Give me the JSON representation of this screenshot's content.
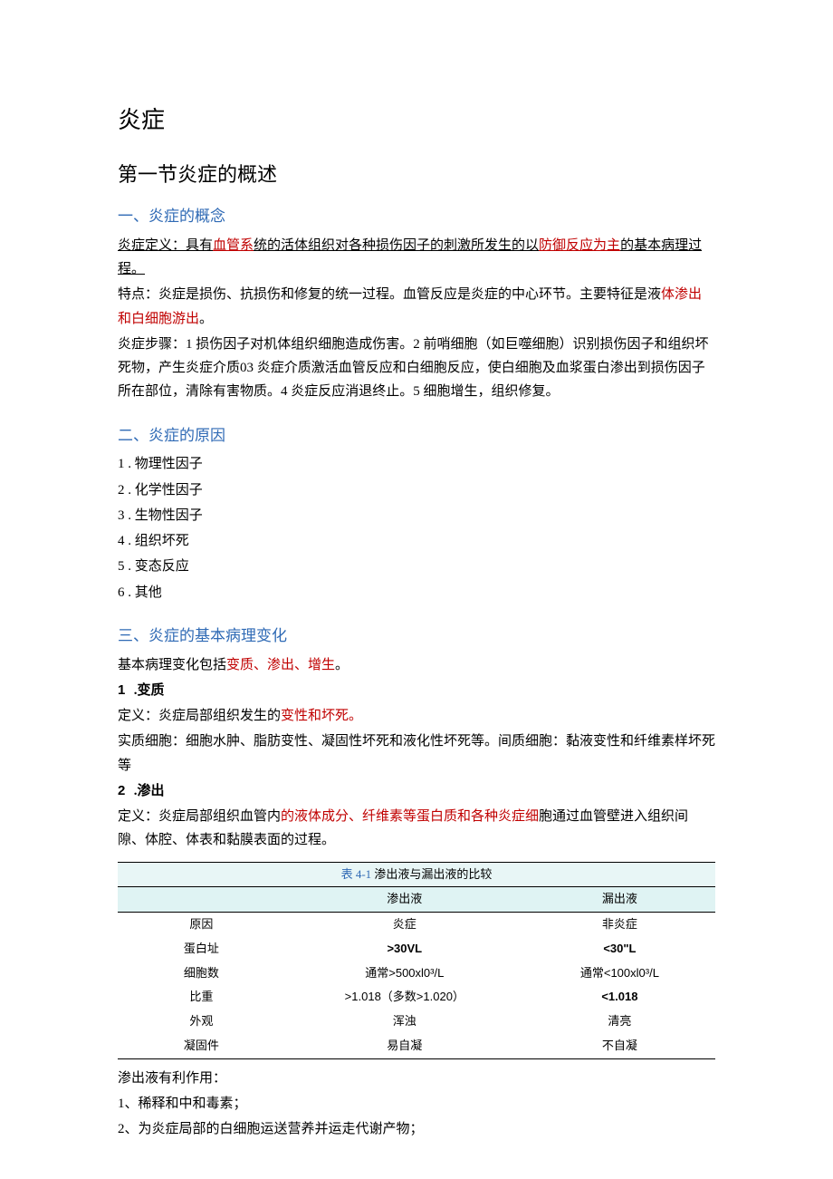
{
  "title": "炎症",
  "section1": {
    "heading": "第一节炎症的概述",
    "sub1": {
      "heading": "一、炎症的概念",
      "def_pre": "炎症定义：具有",
      "def_red1": "血管系",
      "def_mid": "统的活体组织对各种损伤因子的刺激所发生的以",
      "def_red2": "防御反应为主",
      "def_post": "的基本病理过程。",
      "feat_pre": "特点：炎症是损伤、抗损伤和修复的统一过程。血管反应是炎症的中心环节。主要特征是液",
      "feat_red": "体渗出和白细胞游出",
      "feat_post": "。",
      "steps": "炎症步骤：1 损伤因子对机体组织细胞造成伤害。2 前哨细胞（如巨噬细胞）识别损伤因子和组织坏死物，产生炎症介质03 炎症介质激活血管反应和白细胞反应，使白细胞及血浆蛋白渗出到损伤因子所在部位，清除有害物质。4 炎症反应消退终止。5 细胞增生，组织修复。"
    },
    "sub2": {
      "heading": "二、炎症的原因",
      "items": [
        "1 . 物理性因子",
        "2 . 化学性因子",
        "3 . 生物性因子",
        "4 . 组织坏死",
        "5 . 变态反应",
        "6 . 其他"
      ]
    },
    "sub3": {
      "heading": "三、炎症的基本病理变化",
      "intro_pre": "基本病理变化包括",
      "intro_red": "变质、渗出、增生",
      "intro_post": "。",
      "p1_num": "1",
      "p1_title": " .变质",
      "p1_def_pre": "定义：炎症局部组织发生的",
      "p1_def_red": "变性和坏死。",
      "p1_body": "实质细胞：细胞水肿、脂肪变性、凝固性坏死和液化性坏死等。间质细胞：黏液变性和纤维素样坏死等",
      "p2_num": "2",
      "p2_title": " .渗出",
      "p2_def_pre": "定义：炎症局部组织血管内",
      "p2_def_red": "的液体成分、纤维素等蛋白质和各种炎症细",
      "p2_def_post": "胞通过血管壁进入组织间隙、体腔、体表和黏膜表面的过程。",
      "table": {
        "caption_pre": "表 4-1 ",
        "caption": "渗出液与漏出液的比较",
        "headers": [
          "",
          "渗出液",
          "漏出液"
        ],
        "rows": [
          [
            "原因",
            "炎症",
            "非炎症"
          ],
          [
            "蛋白址",
            ">30VL",
            "<30\"L"
          ],
          [
            "细胞数",
            "通常>500xl0³/L",
            "通常<100xl0³/L"
          ],
          [
            "比重",
            ">1.018（多数>1.020）",
            "<1.018"
          ],
          [
            "外观",
            "浑浊",
            "清亮"
          ],
          [
            "凝固件",
            "易自凝",
            "不自凝"
          ]
        ]
      },
      "after1": "渗出液有利作用：",
      "after2": "1、稀释和中和毒素；",
      "after3": "2、为炎症局部的白细胞运送营养并运走代谢产物；"
    }
  }
}
